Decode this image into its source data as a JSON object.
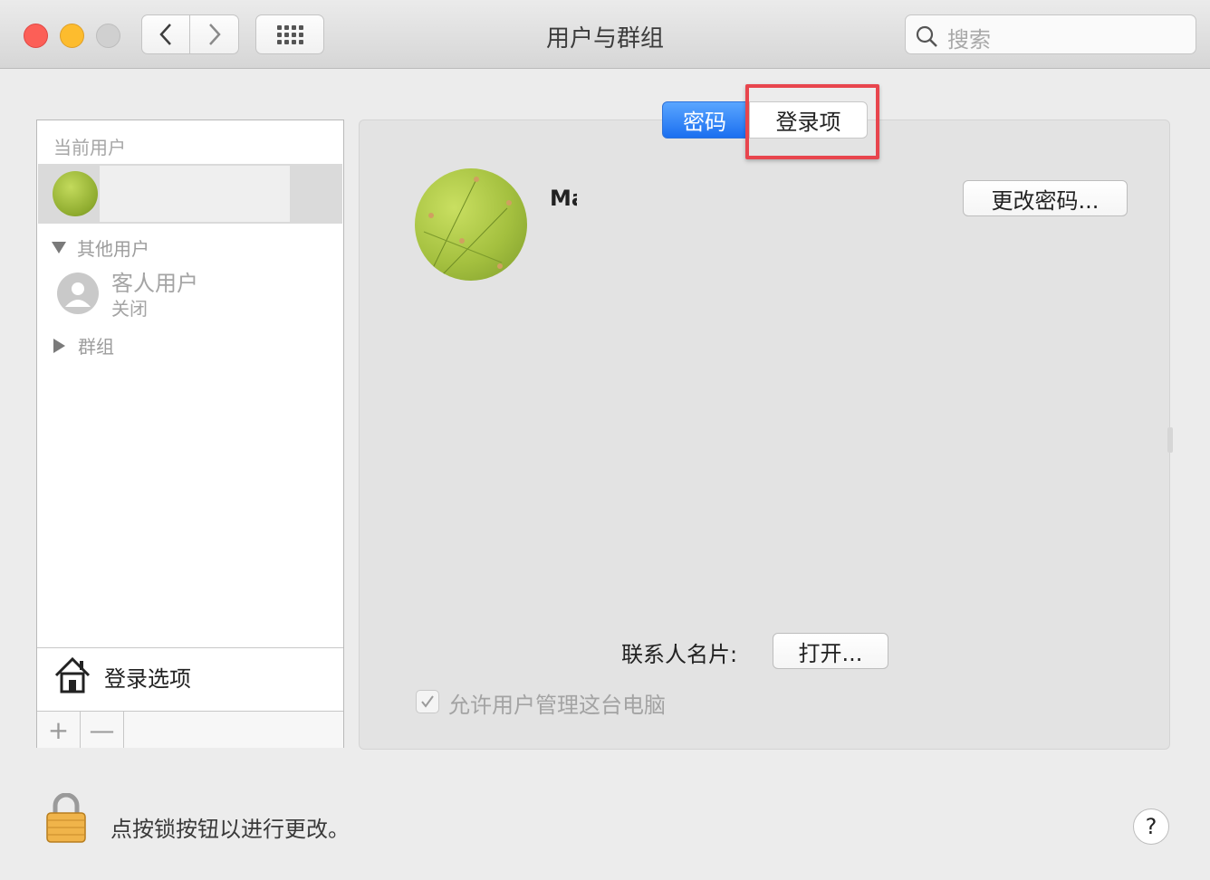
{
  "window": {
    "title": "用户与群组",
    "search_placeholder": "搜索"
  },
  "sidebar": {
    "current_users_label": "当前用户",
    "other_users_label": "其他用户",
    "guest": {
      "name": "客人用户",
      "status": "关闭"
    },
    "groups_label": "群组",
    "login_options_label": "登录选项",
    "add_symbol": "+",
    "remove_symbol": "—"
  },
  "main": {
    "tabs": [
      {
        "label": "密码",
        "selected": true
      },
      {
        "label": "登录项",
        "selected": false
      }
    ],
    "username_partial": "Ma",
    "change_password_label": "更改密码...",
    "contact_card_label": "联系人名片:",
    "open_label": "打开...",
    "allow_admin_label": "允许用户管理这台电脑",
    "allow_admin_checked": true
  },
  "footer": {
    "lock_text": "点按锁按钮以进行更改。",
    "help_label": "?"
  },
  "colors": {
    "accent_tab": "#1b6ff0",
    "highlight_box": "#e8454d",
    "traffic_red": "#fc5f57",
    "traffic_yellow": "#fdbc2e"
  },
  "icons": [
    "back-chevron-icon",
    "forward-chevron-icon",
    "grid-icon",
    "search-icon",
    "house-icon",
    "person-icon",
    "lock-icon",
    "help-icon"
  ]
}
